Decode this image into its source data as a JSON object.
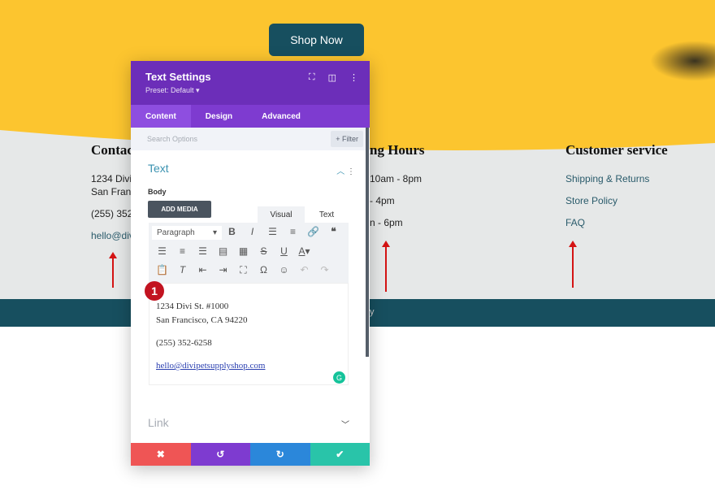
{
  "page": {
    "shop_button": "Shop Now",
    "columns": [
      {
        "heading": "Contac",
        "lines": [
          "1234 Divi",
          "San Franc",
          "(255) 352",
          "hello@div"
        ]
      },
      {
        "heading": "ng Hours",
        "lines": [
          "10am - 8pm",
          "- 4pm",
          "n - 6pm"
        ]
      },
      {
        "heading": "Customer service",
        "lines": [
          "Shipping & Returns",
          "Store Policy",
          "FAQ"
        ]
      }
    ],
    "footer_fragment": "y",
    "colors": {
      "yellow": "#fcc52f",
      "gray": "#e6e8e8",
      "teal": "#174f5f",
      "arrow": "#d41414"
    }
  },
  "panel": {
    "title": "Text Settings",
    "preset": "Preset: Default ▾",
    "header_icons": [
      "focus-icon",
      "split-view-icon",
      "more-vert-icon"
    ],
    "tabs": [
      "Content",
      "Design",
      "Advanced"
    ],
    "active_tab": "Content",
    "search_placeholder": "Search Options",
    "filter": "+ Filter",
    "section": "Text",
    "body_label": "Body",
    "add_media": "ADD MEDIA",
    "editor_tabs": [
      "Visual",
      "Text"
    ],
    "format_select": "Paragraph",
    "badge": "1",
    "content": [
      "1234 Divi St. #1000",
      "San Francisco, CA 94220",
      "(255) 352-6258",
      "hello@divipetsupplyshop.com"
    ],
    "link_section": "Link",
    "colors": {
      "header": "#6c2eb9",
      "tabs": "#7e3bd0",
      "discard": "#ef5555",
      "undo": "#7e3bd0",
      "redo": "#2b87da",
      "save": "#29c4a9"
    }
  }
}
